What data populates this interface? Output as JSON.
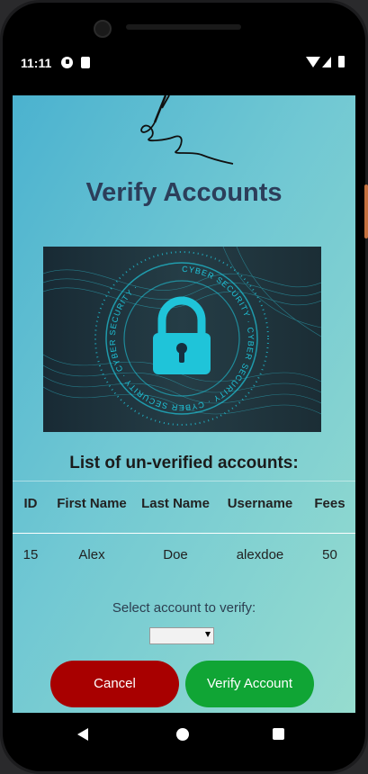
{
  "status_bar": {
    "time": "11:11"
  },
  "page": {
    "title": "Verify Accounts",
    "banner_ring_text": "CYBER SECURITY · CYBER SECURITY · CYBER SECURITY · CYBER SECURITY ·",
    "list_title": "List of un-verified accounts:",
    "table": {
      "headers": {
        "id": "ID",
        "first_name": "First Name",
        "last_name": "Last Name",
        "username": "Username",
        "fees": "Fees"
      },
      "rows": [
        {
          "id": "15",
          "first_name": "Alex",
          "last_name": "Doe",
          "username": "alexdoe",
          "fees": "50"
        }
      ]
    },
    "select_label": "Select account to verify:",
    "select_value": "",
    "cancel_label": "Cancel",
    "verify_label": "Verify Account"
  },
  "colors": {
    "cancel": "#a80000",
    "verify": "#10a535",
    "title": "#2c3e5a",
    "banner_accent": "#1fc4d9"
  },
  "icons": {
    "status": [
      "app-notification-icon",
      "sim-card-icon",
      "wifi-icon",
      "signal-icon",
      "battery-icon"
    ],
    "banner": "padlock-icon",
    "nav": [
      "back-icon",
      "home-icon",
      "recents-icon"
    ]
  }
}
